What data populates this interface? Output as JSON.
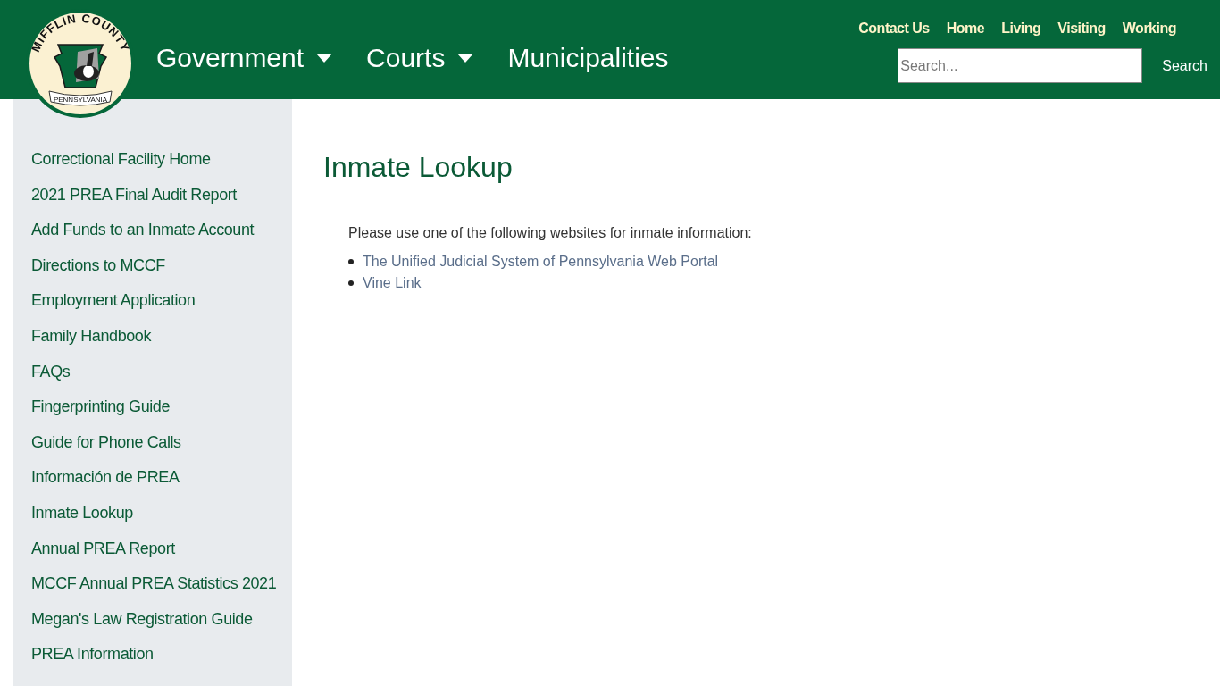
{
  "logo": {
    "top_text": "MIFFLIN COUNTY",
    "banner_text": "PENNSYLVANIA"
  },
  "main_nav": [
    {
      "label": "Government",
      "has_dropdown": true
    },
    {
      "label": "Courts",
      "has_dropdown": true
    },
    {
      "label": "Municipalities",
      "has_dropdown": false
    }
  ],
  "top_links": [
    "Contact Us",
    "Home",
    "Living",
    "Visiting",
    "Working"
  ],
  "search": {
    "placeholder": "Search...",
    "button": "Search"
  },
  "sidebar": {
    "items": [
      "Correctional Facility Home",
      "2021 PREA Final Audit Report",
      "Add Funds to an Inmate Account",
      "Directions to MCCF",
      "Employment Application",
      "Family Handbook",
      "FAQs",
      "Fingerprinting Guide",
      "Guide for Phone Calls",
      "Información de PREA",
      "Inmate Lookup",
      "Annual PREA Report",
      "MCCF Annual PREA Statistics 2021",
      "Megan's Law Registration Guide",
      "PREA Information"
    ]
  },
  "content": {
    "title": "Inmate Lookup",
    "intro": "Please use one of the following websites for inmate information:",
    "links": [
      "The Unified Judicial System of Pennsylvania Web Portal",
      "Vine Link"
    ]
  }
}
